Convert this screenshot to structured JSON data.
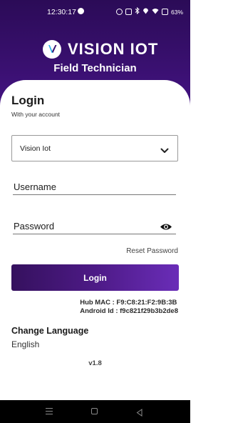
{
  "status_bar": {
    "time": "12:30:17",
    "battery": "63%"
  },
  "brand": {
    "logo_text": "VISION IOT",
    "subtitle": "Field Technician",
    "accent": "#451486"
  },
  "login": {
    "title": "Login",
    "subtitle": "With your account",
    "org_select": {
      "selected": "Vision Iot"
    },
    "username_placeholder": "Username",
    "password_placeholder": "Password",
    "reset_password": "Reset Password",
    "submit": "Login"
  },
  "device": {
    "hub_mac": "Hub MAC : F9:C8:21:F2:9B:3B",
    "android_id": "Android Id : f9c821f29b3b2de8"
  },
  "language": {
    "title": "Change Language",
    "value": "English"
  },
  "version": "v1.8",
  "icons": [
    "alarm-icon",
    "vibrate-icon",
    "bluetooth-icon",
    "location-icon",
    "wifi-icon",
    "battery-icon",
    "chevron-down-icon",
    "eye-icon",
    "menu-icon",
    "home-icon",
    "back-icon"
  ]
}
